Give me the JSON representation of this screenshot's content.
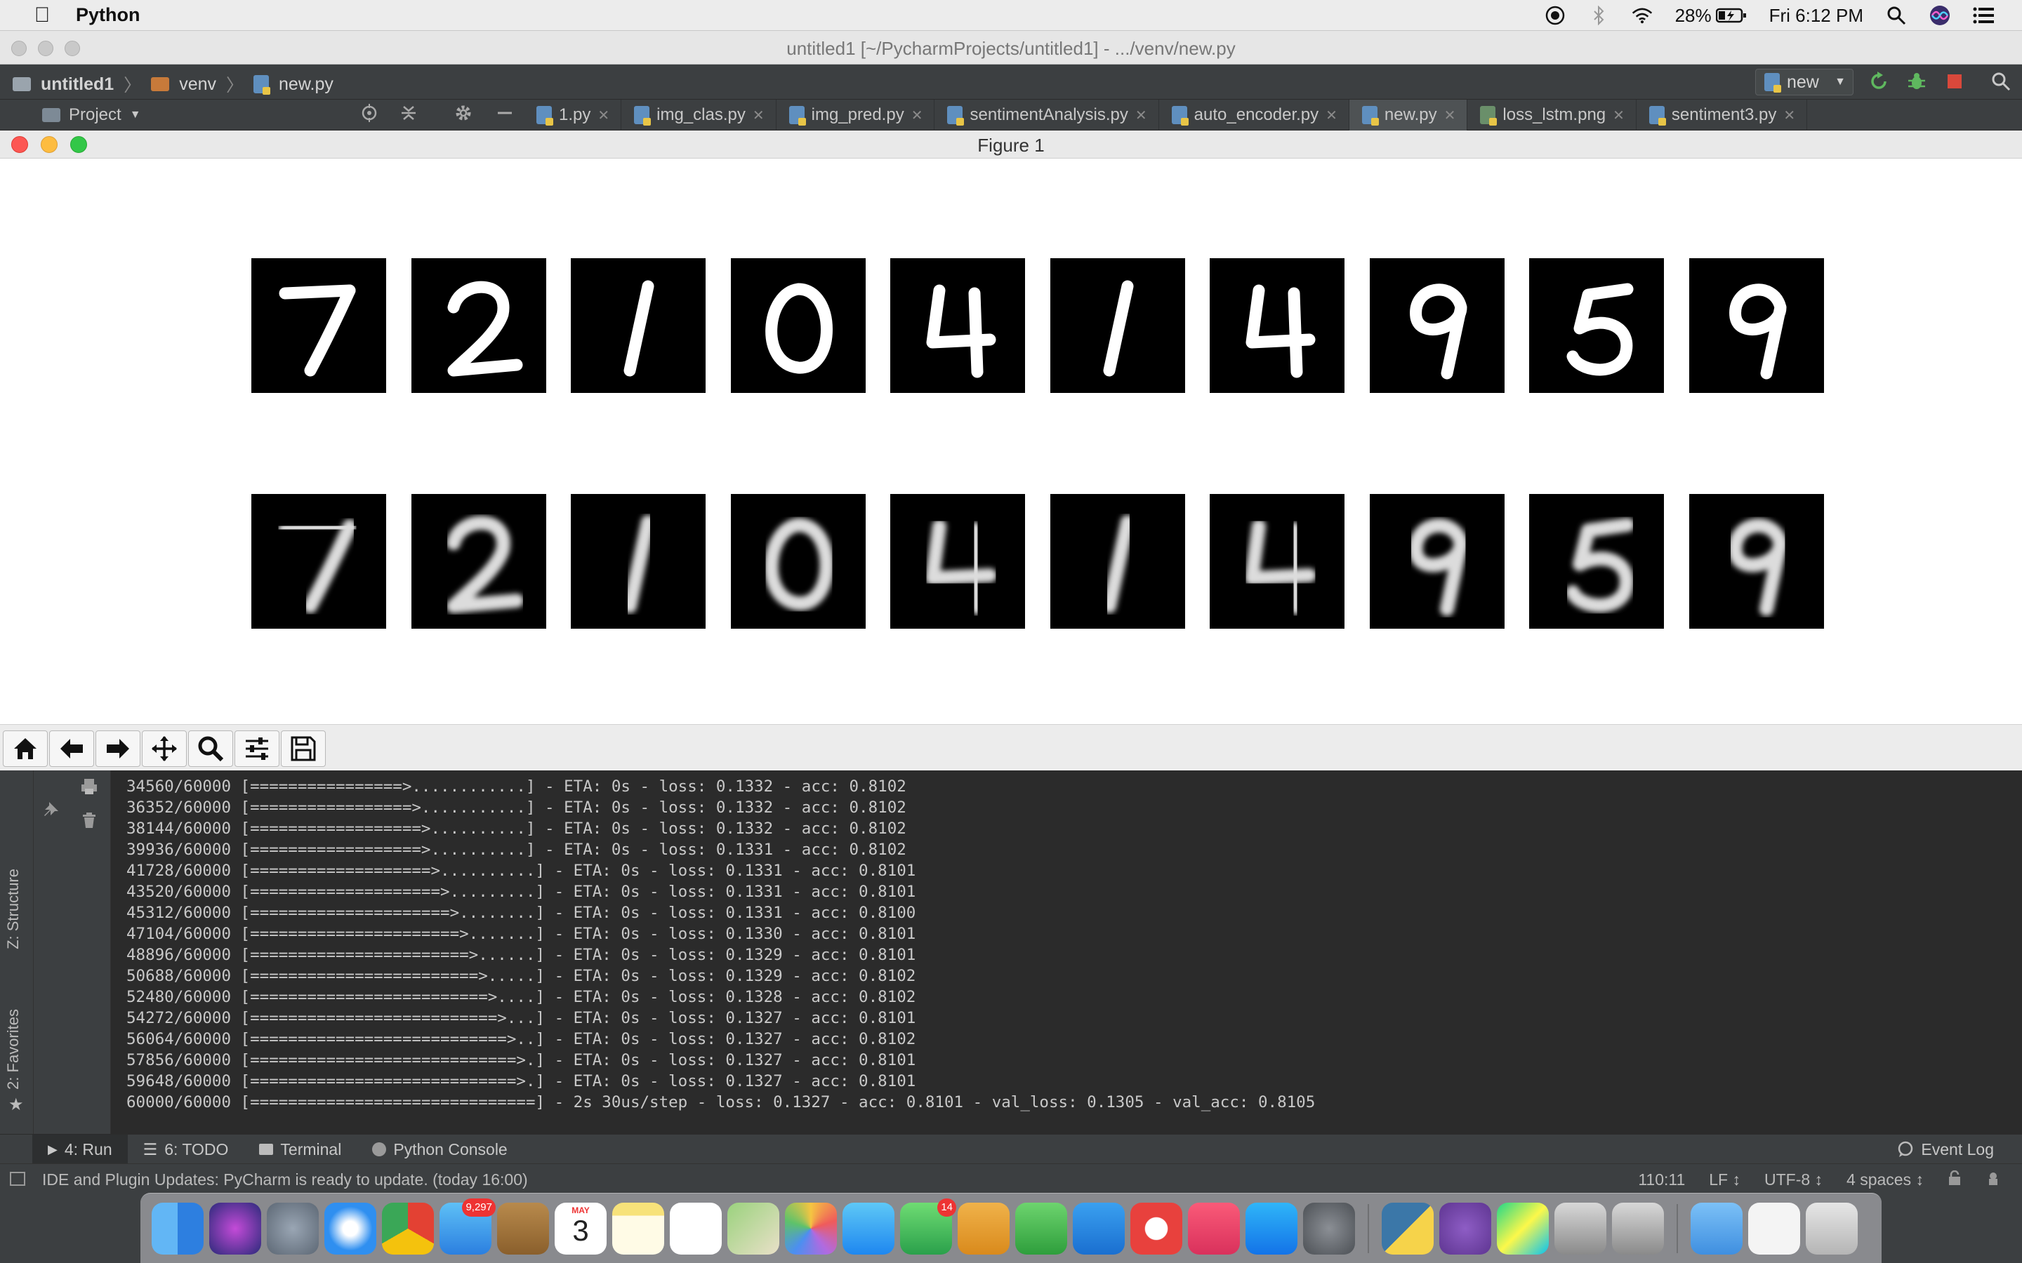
{
  "menubar": {
    "app_name": "Python",
    "battery": "28%",
    "clock": "Fri 6:12 PM"
  },
  "ide": {
    "window_title": "untitled1 [~/PycharmProjects/untitled1] - .../venv/new.py",
    "breadcrumbs": [
      "untitled1",
      "venv",
      "new.py"
    ],
    "run_config": "new",
    "project_label": "Project",
    "tabs": [
      "1.py",
      "img_clas.py",
      "img_pred.py",
      "sentimentAnalysis.py",
      "auto_encoder.py",
      "new.py",
      "loss_lstm.png",
      "sentiment3.py"
    ],
    "active_tab": "new.py"
  },
  "figure": {
    "title": "Figure 1",
    "originals": [
      "7",
      "2",
      "1",
      "0",
      "4",
      "1",
      "4",
      "9",
      "5",
      "9"
    ],
    "reconstructions": [
      "7",
      "2",
      "1",
      "0",
      "4",
      "1",
      "4",
      "9",
      "5",
      "9"
    ]
  },
  "console": {
    "lines": [
      "34560/60000 [================>............] - ETA: 0s - loss: 0.1332 - acc: 0.8102",
      "36352/60000 [=================>...........] - ETA: 0s - loss: 0.1332 - acc: 0.8102",
      "38144/60000 [==================>..........] - ETA: 0s - loss: 0.1332 - acc: 0.8102",
      "39936/60000 [==================>..........] - ETA: 0s - loss: 0.1331 - acc: 0.8102",
      "41728/60000 [===================>..........] - ETA: 0s - loss: 0.1331 - acc: 0.8101",
      "43520/60000 [====================>.........] - ETA: 0s - loss: 0.1331 - acc: 0.8101",
      "45312/60000 [=====================>........] - ETA: 0s - loss: 0.1331 - acc: 0.8100",
      "47104/60000 [======================>.......] - ETA: 0s - loss: 0.1330 - acc: 0.8101",
      "48896/60000 [=======================>......] - ETA: 0s - loss: 0.1329 - acc: 0.8101",
      "50688/60000 [========================>.....] - ETA: 0s - loss: 0.1329 - acc: 0.8102",
      "52480/60000 [=========================>....] - ETA: 0s - loss: 0.1328 - acc: 0.8102",
      "54272/60000 [==========================>...] - ETA: 0s - loss: 0.1327 - acc: 0.8101",
      "56064/60000 [===========================>..] - ETA: 0s - loss: 0.1327 - acc: 0.8102",
      "57856/60000 [============================>.] - ETA: 0s - loss: 0.1327 - acc: 0.8101",
      "59648/60000 [============================>.] - ETA: 0s - loss: 0.1327 - acc: 0.8101",
      "60000/60000 [==============================] - 2s 30us/step - loss: 0.1327 - acc: 0.8101 - val_loss: 0.1305 - val_acc: 0.8105"
    ]
  },
  "side_tabs": {
    "structure": "Z: Structure",
    "favorites": "2: Favorites"
  },
  "tool_windows": {
    "run": "4: Run",
    "todo": "6: TODO",
    "terminal": "Terminal",
    "python_console": "Python Console",
    "event_log": "Event Log"
  },
  "status": {
    "message": "IDE and Plugin Updates: PyCharm is ready to update. (today 16:00)",
    "position": "110:11",
    "line_sep": "LF ↕",
    "encoding": "UTF-8 ↕",
    "indent": "4 spaces ↕"
  },
  "dock": {
    "mail_badge": "9,297",
    "facetime_badge": "14",
    "calendar_month": "MAY",
    "calendar_day": "3",
    "icons": [
      "finder-icon",
      "siri-icon",
      "launchpad-icon",
      "safari-icon",
      "chrome-icon",
      "mail-icon",
      "contacts-icon",
      "calendar-icon",
      "notes-icon",
      "reminders-icon",
      "maps-icon",
      "photos-icon",
      "messages-icon",
      "facetime-icon",
      "keynote-icon",
      "numbers-icon",
      "presentation-icon",
      "news-icon",
      "music-icon",
      "appstore-icon",
      "system-preferences-icon",
      "python-launcher-icon",
      "github-icon",
      "pycharm-icon",
      "pen-tool-icon",
      "pen-tool-2-icon",
      "folder-icon",
      "document-icon",
      "trash-icon"
    ]
  },
  "colors": {
    "ide_bg": "#3c3f41",
    "console_bg": "#2b2b2b",
    "console_text": "#c8c8c8",
    "figure_bg": "#ffffff"
  }
}
